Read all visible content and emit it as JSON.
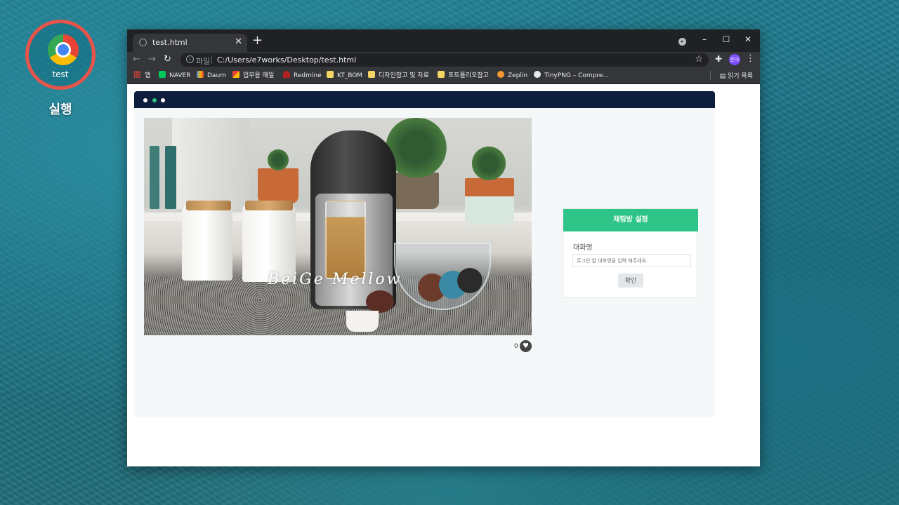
{
  "desktop": {
    "shortcut_label": "test",
    "run_label": "실행",
    "highlight_color": "#e8534a"
  },
  "browser": {
    "tab": {
      "title": "test.html",
      "close_icon": "close-icon"
    },
    "window_controls": {
      "minimize": "–",
      "maximize": "☐",
      "close": "✕"
    },
    "toolbar": {
      "back": "←",
      "forward": "→",
      "reload": "↻",
      "scheme_label": "파일",
      "url": "C:/Users/e7works/Desktop/test.html",
      "profile_initials": "은아"
    },
    "bookmarks": [
      {
        "label": "앱",
        "icon": "apps-grid-icon"
      },
      {
        "label": "NAVER",
        "icon": "naver-icon"
      },
      {
        "label": "Daum",
        "icon": "daum-icon"
      },
      {
        "label": "업무용 메일",
        "icon": "gmail-icon"
      },
      {
        "label": "Redmine",
        "icon": "redmine-icon"
      },
      {
        "label": "KT_BOM",
        "icon": "folder-icon"
      },
      {
        "label": "디자인참고 및 자료",
        "icon": "folder-icon"
      },
      {
        "label": "포트폴리오참고",
        "icon": "folder-icon"
      },
      {
        "label": "Zeplin",
        "icon": "zeplin-icon"
      },
      {
        "label": "TinyPNG – Compre...",
        "icon": "tinypng-icon"
      }
    ],
    "reading_list_label": "읽기 목록"
  },
  "page": {
    "header_dots": [
      "#ffffff",
      "#2ec487",
      "#ffffff"
    ],
    "photo": {
      "watermark": "BeiGe Mellow"
    },
    "like": {
      "count": "0"
    },
    "chat_settings": {
      "title": "채팅방 설정",
      "name_label": "대화명",
      "name_placeholder": "로그인 할 대화명을 입력 해주세요.",
      "confirm_label": "확인",
      "accent_color": "#2ec487"
    },
    "header_color": "#0d1f3c"
  }
}
